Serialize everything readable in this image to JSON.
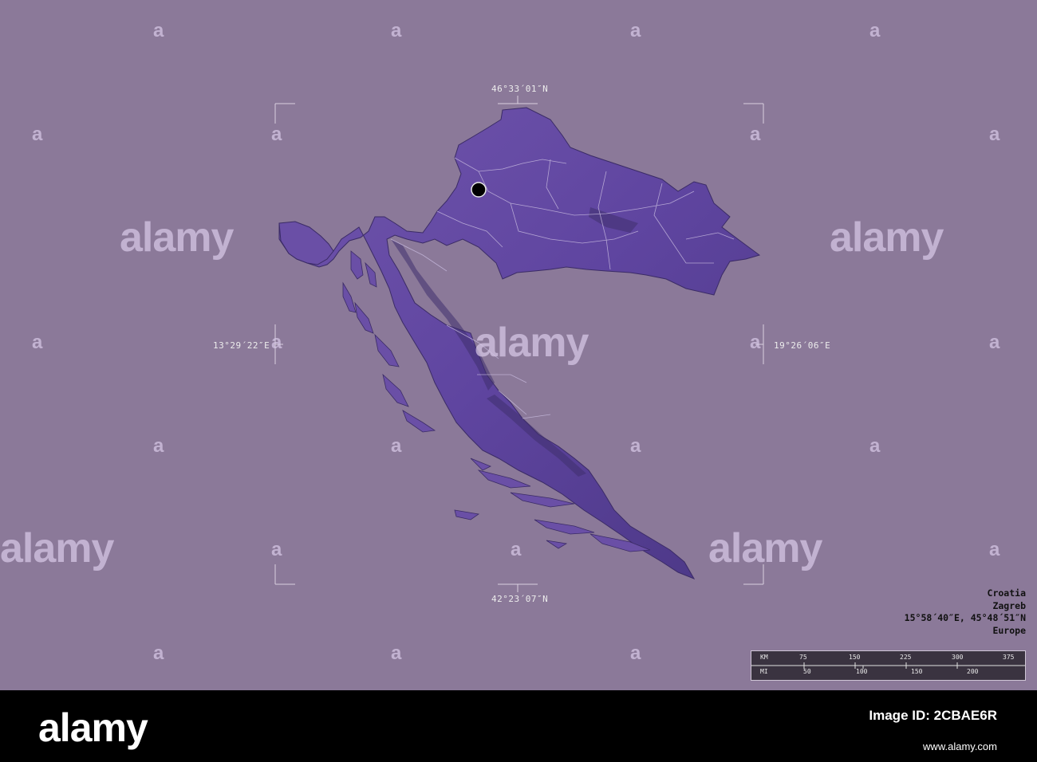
{
  "map": {
    "coords": {
      "north": "46°33´01″N",
      "south": "42°23´07″N",
      "west": "13°29´22″E",
      "east": "19°26´06″E"
    },
    "capital_marker": "Zagreb",
    "colors": {
      "background": "#8b7999",
      "land": "#6b4ea6",
      "land_dark": "#3f2f6e",
      "borders": "#c9bce0"
    }
  },
  "info": {
    "country": "Croatia",
    "capital": "Zagreb",
    "coordinates": "15°58´40″E, 45°48´51″N",
    "region": "Europe"
  },
  "scalebar": {
    "km_label": "KM",
    "mi_label": "MI",
    "km_ticks": [
      "75",
      "150",
      "225",
      "300",
      "375"
    ],
    "mi_ticks": [
      "50",
      "100",
      "150",
      "200"
    ]
  },
  "watermark": {
    "logo": "alamy",
    "mark": "a"
  },
  "footer": {
    "logo": "alamy",
    "image_id_label": "Image ID: 2CBAE6R",
    "url": "www.alamy.com"
  }
}
